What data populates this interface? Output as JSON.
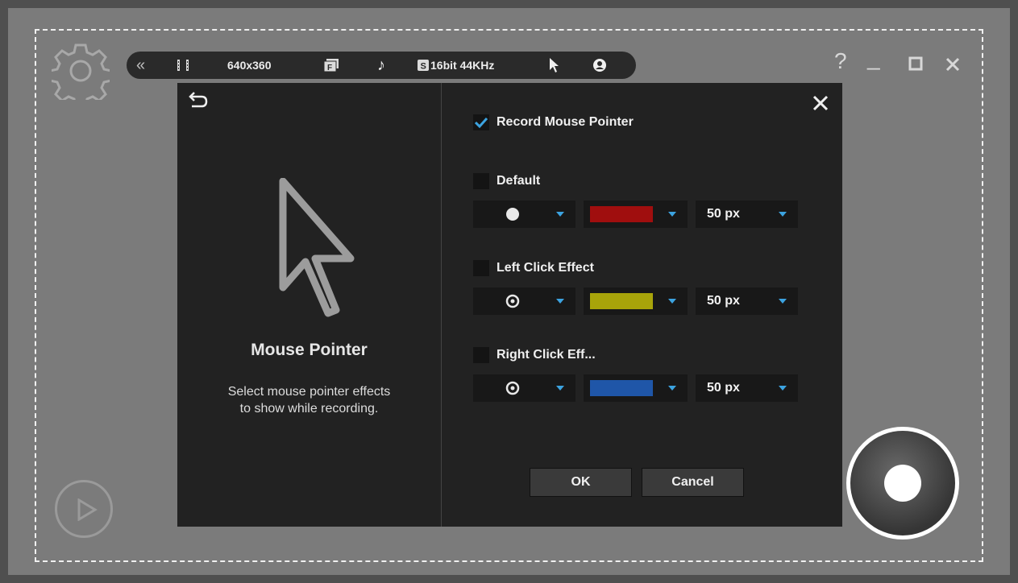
{
  "toolbar": {
    "resolution": "640x360",
    "audio_format": "16bit 44KHz",
    "icons": [
      "collapse-icon",
      "film-icon",
      "fps-icon",
      "music-note-icon",
      "sound-icon",
      "cursor-icon",
      "webcam-icon"
    ]
  },
  "window_controls": {
    "help": "?",
    "minimize": "_",
    "maximize": "☐",
    "close": "✕"
  },
  "dialog": {
    "title": "Mouse Pointer",
    "description_line1": "Select mouse pointer effects",
    "description_line2": "to show while recording.",
    "record_pointer": {
      "label": "Record Mouse Pointer",
      "checked": true
    },
    "effects": [
      {
        "label": "Default",
        "checked": false,
        "shape": "filled-circle",
        "color": "#a00e0e",
        "size": "50 px"
      },
      {
        "label": "Left Click Effect",
        "checked": false,
        "shape": "ring-circle",
        "color": "#a8a40a",
        "size": "50 px"
      },
      {
        "label": "Right Click Eff...",
        "checked": false,
        "shape": "ring-circle",
        "color": "#1f56a8",
        "size": "50 px"
      }
    ],
    "ok_label": "OK",
    "cancel_label": "Cancel"
  },
  "colors": {
    "accent": "#3ca3e0",
    "dialog_bg": "#222222",
    "capture_bg": "#7b7b7b"
  }
}
